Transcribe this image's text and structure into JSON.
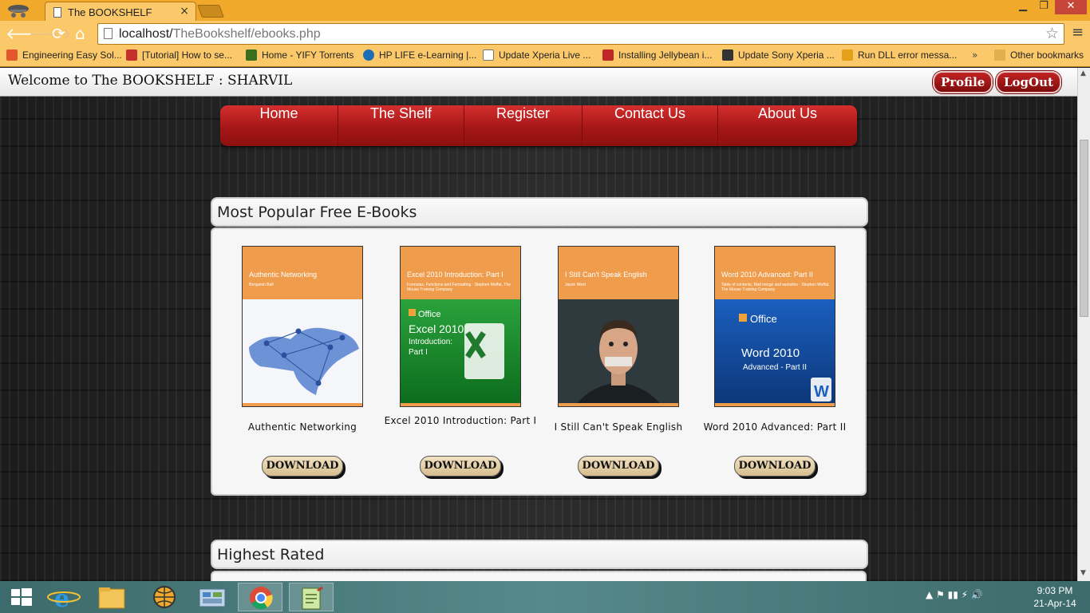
{
  "browser": {
    "tab_title": "The BOOKSHELF",
    "tab_close": "×",
    "window_controls": {
      "minimize": "▁",
      "maximize": "❐",
      "close": "✕"
    },
    "url_host": "localhost/",
    "url_path": "TheBookshelf/ebooks.php",
    "nav_icons": {
      "back": "arrow-left-icon",
      "forward": "arrow-right-icon",
      "reload": "reload-icon",
      "home": "home-icon"
    },
    "star": "☆",
    "menu": "≡"
  },
  "bookmarks": [
    {
      "label": "Engineering Easy Sol...",
      "color": "#e2572b"
    },
    {
      "label": "[Tutorial] How to se...",
      "color": "#c4302b"
    },
    {
      "label": "Home - YIFY Torrents",
      "color": "#3a6f1e"
    },
    {
      "label": "HP LIFE e-Learning |...",
      "color": "#1c6fb5"
    },
    {
      "label": "Update Xperia Live ...",
      "color": "#ffffff"
    },
    {
      "label": "Installing Jellybean i...",
      "color": "#c02828"
    },
    {
      "label": "Update Sony Xperia ...",
      "color": "#333333"
    },
    {
      "label": "Run DLL error messa...",
      "color": "#e4a017"
    }
  ],
  "bookmarks_more": "»",
  "other_bookmarks": "Other bookmarks",
  "site": {
    "welcome": "Welcome to The BOOKSHELF : SHARVIL",
    "profile": "Profile",
    "logout": "LogOut",
    "nav": [
      "Home",
      "The Shelf",
      "Register",
      "Contact Us",
      "About Us"
    ],
    "section1_title": "Most Popular Free E-Books",
    "section2_title": "Highest Rated",
    "download_label": "DOWNLOAD",
    "books": [
      {
        "title": "Authentic Networking",
        "cover_title": "Authentic Networking",
        "cover_sub": "Benjamin Ball",
        "art": "world-network",
        "art_color": "#ffffff"
      },
      {
        "title": "Excel 2010 Introduction: Part I",
        "cover_title": "Excel 2010 Introduction: Part I",
        "cover_sub": "Formulas, Functions and Formatting · Stephen Moffat, The Mouse Training Company",
        "art": "office-excel",
        "art_color": "#1e8a2c"
      },
      {
        "title": "I Still Can't Speak English",
        "cover_title": "I Still Can't Speak English",
        "cover_sub": "Jason West",
        "art": "taped-mouth-man",
        "art_color": "#2f3a3e"
      },
      {
        "title": "Word 2010 Advanced: Part II",
        "cover_title": "Word 2010 Advanced: Part II",
        "cover_sub": "Table of contents, Mail merge and websites · Stephen Moffat, The Mouse Training Company",
        "art": "office-word",
        "art_color": "#154b9b"
      }
    ]
  },
  "cover_art_text": {
    "excel_brand": "Office",
    "excel_line1": "Excel 2010",
    "excel_line2": "Introduction:",
    "excel_line3": "Part I",
    "word_brand": "Office",
    "word_line1": "Word 2010",
    "word_line2": "Advanced - Part II"
  },
  "taskbar": {
    "items": [
      "start-icon",
      "internet-explorer-icon",
      "file-explorer-icon",
      "globe-app-icon",
      "control-panel-icon",
      "chrome-icon",
      "notepad-icon"
    ],
    "tray_text": "▲  ⚑  ▮▮  ⚡  🔊",
    "time": "9:03 PM",
    "date": "21-Apr-14"
  }
}
